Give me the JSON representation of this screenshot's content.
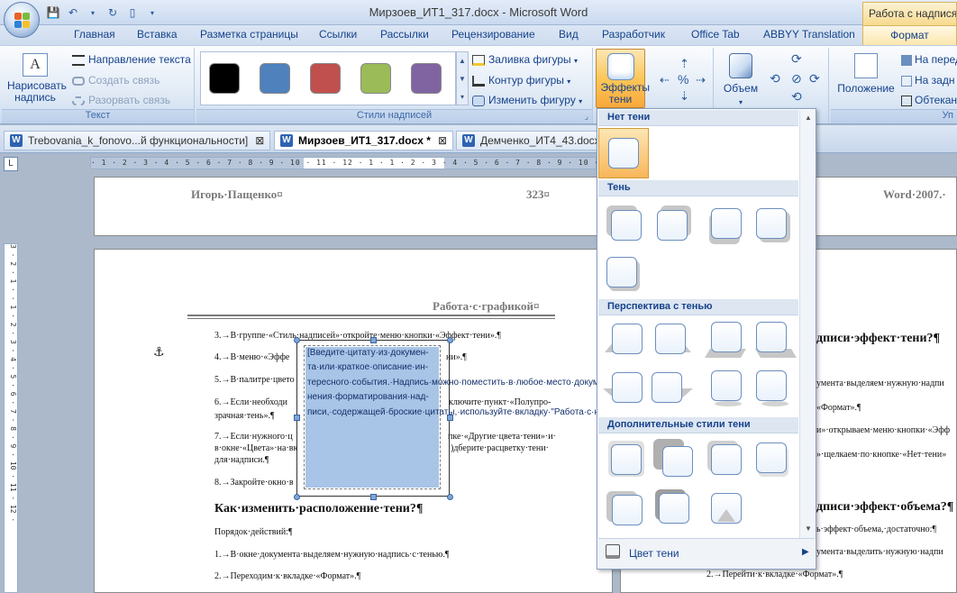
{
  "window": {
    "title": "Мирзоев_ИТ1_317.docx - Microsoft Word",
    "context_title": "Работа с надписями"
  },
  "tabs": [
    "Главная",
    "Вставка",
    "Разметка страницы",
    "Ссылки",
    "Рассылки",
    "Рецензирование",
    "Вид",
    "Разработчик",
    "Office Tab",
    "ABBYY Translation"
  ],
  "tab_active": "Формат",
  "ribbon": {
    "text_group": {
      "draw_label": "Нарисовать надпись",
      "direction": "Направление текста",
      "link": "Создать связь",
      "unlink": "Разорвать связь",
      "label": "Текст"
    },
    "styles_group": {
      "label": "Стили надписей",
      "fill": "Заливка фигуры",
      "outline": "Контур фигуры",
      "change": "Изменить фигуру"
    },
    "effects_label": "Эффекты тени",
    "volume_label": "Объем",
    "position_label": "Положение",
    "arrange": {
      "front": "На перед",
      "back": "На задн",
      "wrap": "Обтекан",
      "label": "Уп"
    }
  },
  "swatch_colors": [
    "#000000",
    "#4f81bd",
    "#c0504d",
    "#9bbb59",
    "#8064a2"
  ],
  "doc_tabs": [
    {
      "label": "Trebovania_k_fonovo...й функциональности]",
      "close": "⊠"
    },
    {
      "label": "Мирзоев_ИТ1_317.docx *",
      "close": "⊠"
    },
    {
      "label": "Демченко_ИТ4_43.docx",
      "close": ""
    }
  ],
  "ruler": {
    "corner": "L",
    "ticks": "· 1 · 2 · 3 · 4 · 5 · 6 · 7 · 8 · 9 · 10 · 11 · 12 · 1 · 1 · 2 · 3 · 4 · 5 · 6 · 7 · 8 · 9 · 10 · 11 · 12 ·",
    "vticks": "3 · 2 · 1 · · 1 · 2 · 3 · 4 · 5 · 6 · 7 · 8 · 9 · 10 · 11 · 12 ·"
  },
  "document": {
    "header_left": "Игорь·Пащенко¤",
    "header_page": "323¤",
    "header_right": "Word·2007.·",
    "section_title": "Работа·с·графикой¤",
    "p1": "3.→В·группе·«Стиль·надписей»·откройте·меню·кнопки·«Эффект·тени».¶",
    "p2": "4.→В·меню·«Эффе",
    "p2b": "ни».¶",
    "p3": "5.→В·палитре·цвето",
    "p4": "6.→Если·необходи",
    "p4b": "ключите·пункт·«Полупро-",
    "p4c": "зрачная·тень».¶",
    "p5": "7.→Если·нужного·ц",
    "p5b": "пке·«Другие·цвета·тени»·и·",
    "p5c": "в·окне·«Цвета»·на·вк",
    "p5d": ")дберите·расцветку·тени·",
    "p5e": "для·надписи.¶",
    "p6": "8.→Закройте·окно·в",
    "h2": "Как·изменить·расположение·тени?¶",
    "p7": "Порядок·действий:¶",
    "p8": "1.→В·окне·документа·выделяем·нужную·надпись·с·тенью.¶",
    "p9": "2.→Переходим·к·вкладке·«Формат».¶",
    "r1": "дписи·эффект·тени?¶",
    "r2": "умента·выделяем·нужную·надпи",
    "r3": "«Формат».¶",
    "r4": "и»·открываем·меню·кнопки·«Эфф",
    "r5": "»·щелкаем·по·кнопке·«Нет·тени»",
    "r6": "дписи·эффект·объема?¶",
    "r7": "ь·эффект·объема,·достаточно:¶",
    "r8": "умента·выделить·нужную·надпи",
    "r9": "2.→Перейти·к·вкладке·«Формат».¶",
    "textbox": "[Введите·цитату·из·докумен-та·или·краткое·описание·ин-тересного·события.·Надпись·можно·поместить·в·любое·место·документа.·Для·изме-нения·форматирования·над-писи,·содержащей·броские·цитаты,·используйте·вкладку·\"Работа·с·надписями\".]¶"
  },
  "gallery": {
    "no_shadow": "Нет тени",
    "shadow": "Тень",
    "perspective": "Перспектива с тенью",
    "additional": "Дополнительные стили тени",
    "shadow_color": "Цвет тени"
  }
}
